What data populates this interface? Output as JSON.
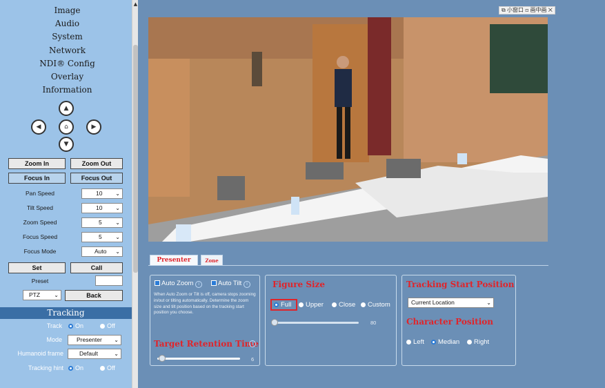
{
  "menu": [
    "Image",
    "Audio",
    "System",
    "Network",
    "NDI® Config",
    "Overlay",
    "Information"
  ],
  "ptz_buttons": {
    "zoom_in": "Zoom In",
    "zoom_out": "Zoom Out",
    "focus_in": "Focus In",
    "focus_out": "Focus Out",
    "set": "Set",
    "call": "Call",
    "back": "Back"
  },
  "speeds": [
    {
      "label": "Pan Speed",
      "value": "10"
    },
    {
      "label": "Tilt Speed",
      "value": "10"
    },
    {
      "label": "Zoom Speed",
      "value": "5"
    },
    {
      "label": "Focus Speed",
      "value": "5"
    },
    {
      "label": "Focus Mode",
      "value": "Auto"
    }
  ],
  "preset_label": "Preset",
  "ptz_select": "PTZ",
  "tracking": {
    "header": "Tracking",
    "track_label": "Track",
    "on": "On",
    "off": "Off",
    "track_value": "On",
    "mode_label": "Mode",
    "mode_value": "Presenter",
    "humanoid_label": "Humanoid frame",
    "humanoid_value": "Default",
    "hint_label": "Tracking hint",
    "hint_value": "On"
  },
  "float_bar": {
    "small": "小窗口",
    "pip": "画中画"
  },
  "tabs": {
    "presenter": "Presenter",
    "zone": "Zone"
  },
  "auto": {
    "zoom": "Auto Zoom",
    "tilt": "Auto Tilt",
    "zoom_checked": true,
    "tilt_checked": true
  },
  "description": "When Auto Zoom or Tilt is off, camera stops zooming in/out or tilting automatically. Determine the zoom size and tilt position based on the tracking start position you choose.",
  "retention": {
    "title": "Target Retention Time",
    "value": "6"
  },
  "figure_size": {
    "title": "Figure Size",
    "options": [
      "Full",
      "Upper",
      "Close",
      "Custom"
    ],
    "selected": "Full",
    "slider_value": "80"
  },
  "tracking_start": {
    "title": "Tracking Start Position",
    "value": "Current Location"
  },
  "character_position": {
    "title": "Character Position",
    "options": [
      "Left",
      "Median",
      "Right"
    ],
    "selected": "Median"
  },
  "colors": {
    "accent_red": "#e0242a",
    "sidebar": "#9cc3e8",
    "panel_bg": "#6b8fb6",
    "tracking_head": "#3a6ea5"
  }
}
